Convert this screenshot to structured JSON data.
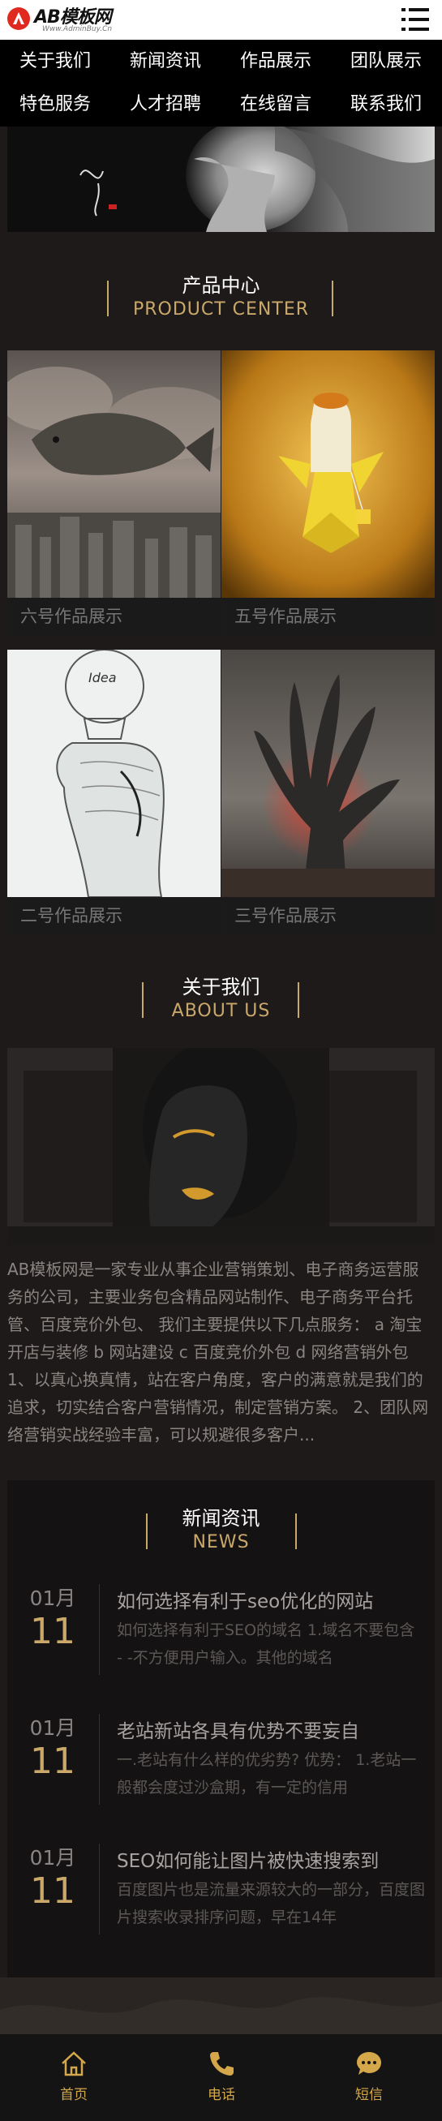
{
  "header": {
    "logo_text": "AB模板网",
    "logo_sub": "Www.AdminBuy.Cn",
    "menu_icon": "hamburger-icon"
  },
  "nav": {
    "items": [
      "关于我们",
      "新闻资讯",
      "作品展示",
      "团队展示",
      "特色服务",
      "人才招聘",
      "在线留言",
      "联系我们"
    ]
  },
  "products": {
    "title_cn": "产品中心",
    "title_en": "PRODUCT CENTER",
    "items": [
      {
        "label": "六号作品展示"
      },
      {
        "label": "五号作品展示"
      },
      {
        "label": "二号作品展示"
      },
      {
        "label": "三号作品展示"
      }
    ]
  },
  "about": {
    "title_cn": "关于我们",
    "title_en": "ABOUT US",
    "text": "AB模板网是一家专业从事企业营销策划、电子商务运营服务的公司，主要业务包含精品网站制作、电子商务平台托管、百度竞价外包、 我们主要提供以下几点服务： a 淘宝开店与装修 b 网站建设 c 百度竞价外包 d 网络营销外包 1、以真心换真情，站在客户角度，客户的满意就是我们的追求，切实结合客户营销情况，制定营销方案。 2、团队网络营销实战经验丰富，可以规避很多客户..."
  },
  "news": {
    "title_cn": "新闻资讯",
    "title_en": "NEWS",
    "items": [
      {
        "month": "01月",
        "day": "11",
        "title": "如何选择有利于seo优化的网站",
        "desc": "如何选择有利于SEO的域名 1.域名不要包含 - -不方便用户输入。其他的域名"
      },
      {
        "month": "01月",
        "day": "11",
        "title": "老站新站各具有优势不要妄自",
        "desc": "一.老站有什么样的优劣势? 优势： 1.老站一般都会度过沙盒期，有一定的信用"
      },
      {
        "month": "01月",
        "day": "11",
        "title": "SEO如何能让图片被快速搜索到",
        "desc": "百度图片也是流量来源较大的一部分，百度图片搜索收录排序问题，早在14年"
      }
    ]
  },
  "tabbar": {
    "items": [
      {
        "label": "首页",
        "icon": "home-icon"
      },
      {
        "label": "电话",
        "icon": "phone-icon"
      },
      {
        "label": "短信",
        "icon": "chat-icon"
      }
    ]
  },
  "colors": {
    "accent": "#c9a86a",
    "tab_accent": "#d4a84a",
    "background": "#1d1a19"
  }
}
